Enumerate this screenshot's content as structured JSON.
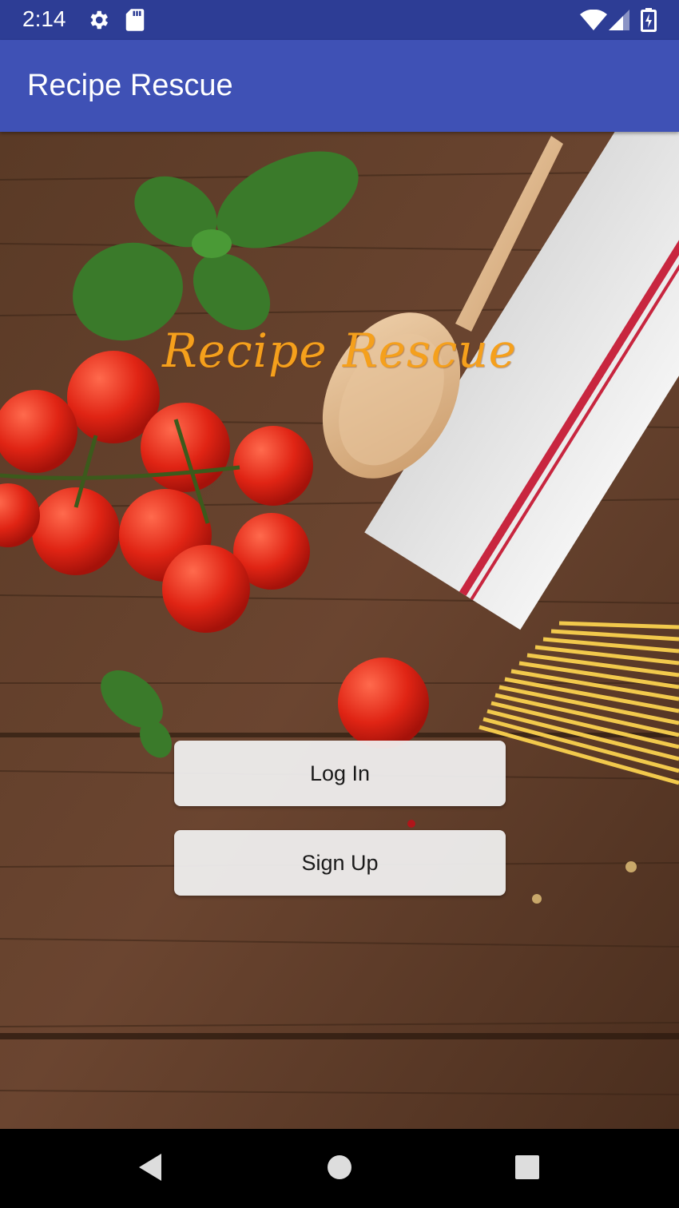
{
  "status_bar": {
    "time": "2:14",
    "icons": [
      "gear-icon",
      "sdcard-icon",
      "wifi-icon",
      "signal-icon",
      "battery-charging-icon"
    ]
  },
  "app_bar": {
    "title": "Recipe Rescue"
  },
  "main": {
    "hero_title": "Recipe Rescue",
    "background": "wooden table with basil, cherry tomatoes, wooden spoon, towel and spaghetti",
    "buttons": {
      "login_label": "Log In",
      "signup_label": "Sign Up"
    }
  },
  "nav_bar": {
    "icons": [
      "back-icon",
      "home-icon",
      "recents-icon"
    ]
  },
  "colors": {
    "status_bar": "#2d3d95",
    "app_bar": "#3f51b5",
    "hero_title": "#f5a01c",
    "button_bg": "#f2f2f2"
  }
}
